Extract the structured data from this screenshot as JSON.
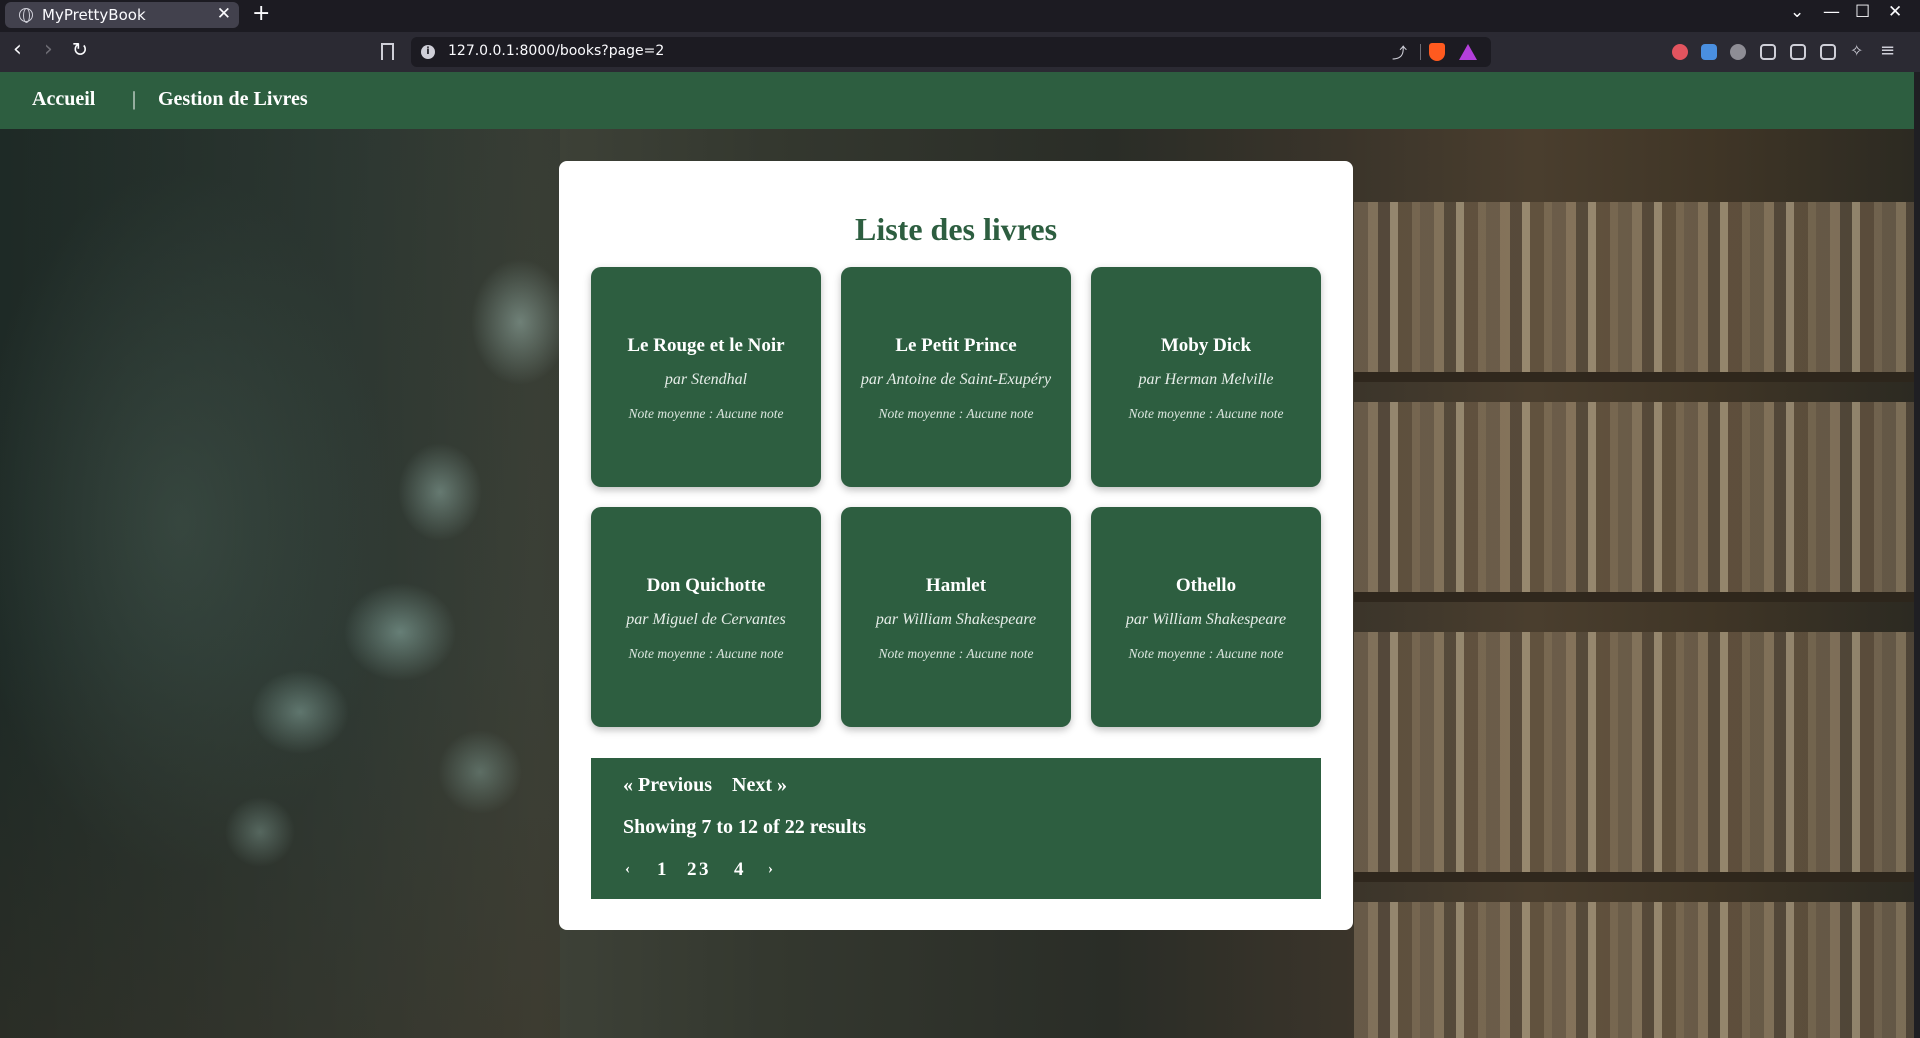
{
  "browser": {
    "tab_title": "MyPrettyBook",
    "tab_close": "✕",
    "new_tab": "+",
    "url": "127.0.0.1:8000/books?page=2",
    "window_controls": [
      "⌄",
      "—",
      "☐",
      "✕"
    ]
  },
  "nav": {
    "home": "Accueil",
    "divider": "|",
    "manage": "Gestion de Livres"
  },
  "main": {
    "heading": "Liste des livres",
    "books": [
      {
        "title": "Le Rouge et le Noir",
        "author": "par Stendhal",
        "rating": "Note moyenne : Aucune note"
      },
      {
        "title": "Le Petit Prince",
        "author": "par Antoine de Saint-Exupéry",
        "rating": "Note moyenne : Aucune note"
      },
      {
        "title": "Moby Dick",
        "author": "par Herman Melville",
        "rating": "Note moyenne : Aucune note"
      },
      {
        "title": "Don Quichotte",
        "author": "par Miguel de Cervantes",
        "rating": "Note moyenne : Aucune note"
      },
      {
        "title": "Hamlet",
        "author": "par William Shakespeare",
        "rating": "Note moyenne : Aucune note"
      },
      {
        "title": "Othello",
        "author": "par William Shakespeare",
        "rating": "Note moyenne : Aucune note"
      }
    ]
  },
  "pagination": {
    "previous": "« Previous",
    "next": "Next »",
    "summary": "Showing 7 to 12 of 22 results",
    "prev_arrow": "‹",
    "next_arrow": "›",
    "pages": [
      "1",
      "2",
      "3",
      "4"
    ]
  },
  "colors": {
    "brand_green": "#2d5e40",
    "panel_bg": "#ffffff"
  }
}
